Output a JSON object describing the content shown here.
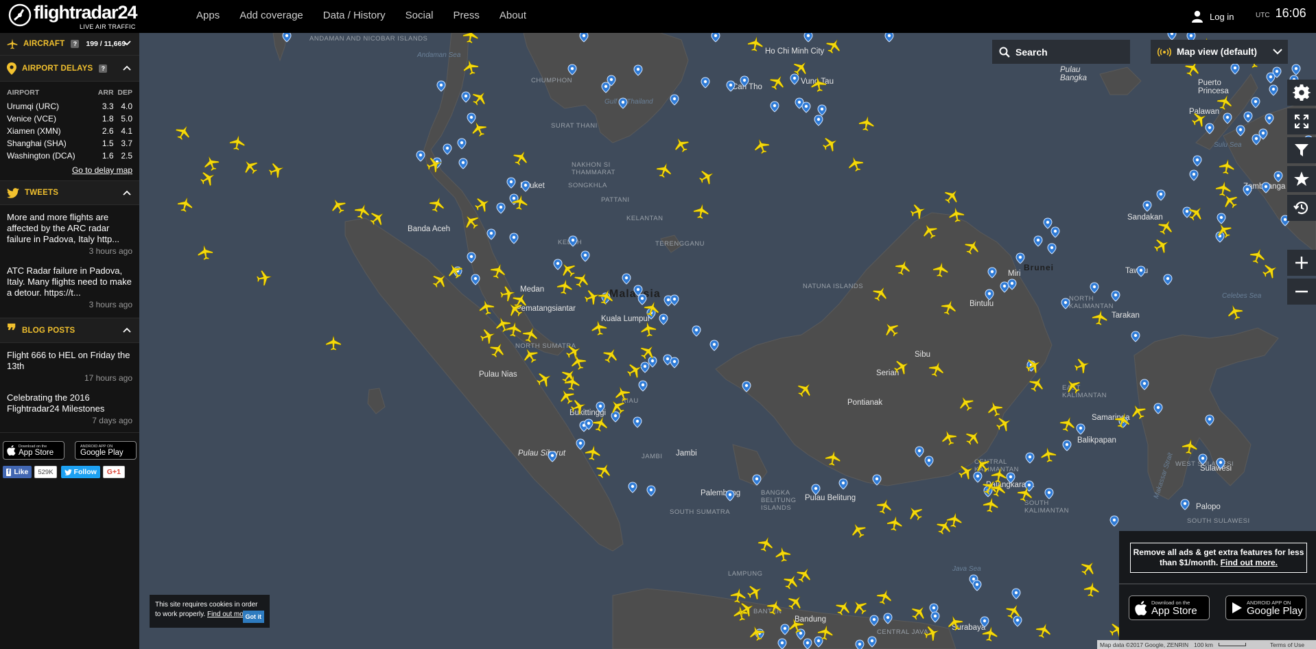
{
  "brand": {
    "name": "flightradar24",
    "tagline": "LIVE AIR TRAFFIC"
  },
  "nav": {
    "items": [
      "Apps",
      "Add coverage",
      "Data / History",
      "Social",
      "Press",
      "About"
    ]
  },
  "header": {
    "login_label": "Log in",
    "utc_label": "UTC",
    "time": "16:06"
  },
  "sidebar": {
    "aircraft": {
      "title": "AIRCRAFT",
      "help": "?",
      "count": "199 / 11,669"
    },
    "delays": {
      "title": "AIRPORT DELAYS",
      "help": "?",
      "columns": [
        "AIRPORT",
        "ARR",
        "DEP"
      ],
      "rows": [
        [
          "Urumqi (URC)",
          "3.3",
          "4.0"
        ],
        [
          "Venice (VCE)",
          "1.8",
          "5.0"
        ],
        [
          "Xiamen (XMN)",
          "2.6",
          "4.1"
        ],
        [
          "Shanghai (SHA)",
          "1.5",
          "3.7"
        ],
        [
          "Washington (DCA)",
          "1.6",
          "2.5"
        ]
      ],
      "link": "Go to delay map"
    },
    "tweets": {
      "title": "TWEETS",
      "items": [
        {
          "text": "More and more flights are affected by the ARC radar failure in Padova, Italy http...",
          "ago": "3 hours ago"
        },
        {
          "text": "ATC Radar failure in Padova, Italy. Many flights need to make a detour. https://t...",
          "ago": "3 hours ago"
        }
      ]
    },
    "blog": {
      "title": "BLOG POSTS",
      "items": [
        {
          "text": "Flight 666 to HEL on Friday the 13th",
          "ago": "17 hours ago"
        },
        {
          "text": "Celebrating the 2016 Flightradar24 Milestones",
          "ago": "7 days ago"
        }
      ]
    },
    "stores": {
      "appstore_small": "Download on the",
      "appstore_big": "App Store",
      "google_small": "ANDROID APP ON",
      "google_big": "Google Play"
    },
    "social": {
      "fb_like": "Like",
      "fb_count": "529K",
      "tw_follow": "Follow",
      "gplus": "G+1"
    }
  },
  "map": {
    "search_placeholder": "Search",
    "view_label": "Map view (default)",
    "labels": {
      "andaman": "ANDAMAN AND NICOBAR ISLANDS",
      "andaman_sea": "Andaman Sea",
      "gulf_thailand": "Gulf of Thailand",
      "hochiminh": "Ho Chi Minh City",
      "vungtau": "Vung Tau",
      "cantho": "Can Tho",
      "malaysia": "Malaysia",
      "kuala": "Kuala Lumpur",
      "medan": "Medan",
      "pematang": "Pematangsiantar",
      "north_sumatra": "NORTH SUMATRA",
      "banda": "Banda Aceh",
      "pulau_nias": "Pulau Nias",
      "bukittinggi": "Bukittinggi",
      "pulau_siberut": "Pulau Siberut",
      "jambi": "JAMBI",
      "jambi_city": "Jambi",
      "palembang": "Palembang",
      "south_sumatra": "SOUTH SUMATRA",
      "bangka": "BANGKA BELITUNG ISLANDS",
      "pulau_belitung": "Pulau Belitung",
      "lampung": "LAMPUNG",
      "java_sea": "Java Sea",
      "banten": "BANTEN",
      "bandung": "Bandung",
      "surabaya": "Surabaya",
      "central_java": "CENTRAL JAVA",
      "riau": "RIAU",
      "pontianak": "Pontianak",
      "serian": "Serian",
      "sibu": "Sibu",
      "bintulu": "Bintulu",
      "miri": "Miri",
      "brunei": "Brunei",
      "central_kal": "CENTRAL KALIMANTAN",
      "palangkaraya": "Palangkaraya",
      "south_kal": "SOUTH KALIMANTAN",
      "east_kal": "EAST KALIMANTAN",
      "north_kal": "NORTH KALIMANTAN",
      "samarinda": "Samarinda",
      "balikpapan": "Balikpapan",
      "tarakan": "Tarakan",
      "tawau": "Tawau",
      "sandakan": "Sandakan",
      "celebes_sea": "Celebes Sea",
      "makassar": "Makassar Strait",
      "west_sulawesi": "WEST SULAWESI",
      "south_sulawesi": "SOUTH SULAWESI",
      "sulawesi": "Sulawesi",
      "palopo": "Palopo",
      "puerto": "Puerto Princesa",
      "palawan": "Palawan",
      "zamboanga": "Zamboanga",
      "sulu_sea": "Sulu Sea",
      "pulau_bangka": "Pulau Bangka",
      "natuna": "NATUNA ISLANDS",
      "kelantan": "KELANTAN",
      "terengganu": "TERENGGANU",
      "kedah": "KEDAH",
      "pattani": "PATTANI",
      "songkhla": "SONGKHLA",
      "nakhon": "NAKHON SI THAMMARAT",
      "chumphon": "CHUMPHON",
      "surat": "SURAT THANI",
      "phuket": "Phuket"
    },
    "promo": {
      "text": "Remove all ads & get extra features for less than $1/month.",
      "link": "Find out more.",
      "appstore_small": "Download on the",
      "appstore_big": "App Store",
      "google_small": "ANDROID APP ON",
      "google_big": "Google Play"
    },
    "cookie": {
      "text": "This site requires cookies in order to work properly.",
      "link": "Find out more.",
      "button": "Got it"
    },
    "attribution": {
      "data": "Map data ©2017 Google, ZENRIN",
      "scale": "100 km",
      "terms": "Terms of Use"
    }
  },
  "colors": {
    "accent": "#f2c12e",
    "plane": "#f5d90a",
    "water": "#3f4b5b",
    "land": "#4e4e4e",
    "pin": "#2f7bd6"
  }
}
